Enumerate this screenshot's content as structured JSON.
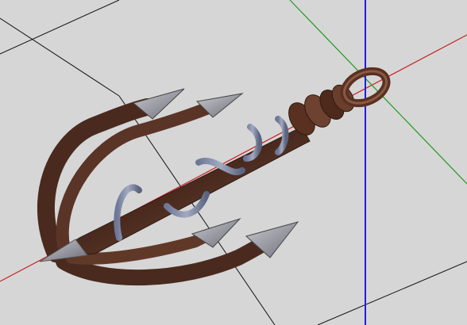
{
  "viewport": {
    "background": "#d6d6d6",
    "grid_color": "#111111",
    "axes": {
      "x_color": "#c81e1e",
      "y_color": "#1e9a1e",
      "z_color": "#1e1ee0"
    }
  },
  "model": {
    "name": "grappling hook",
    "prongs": 4,
    "rust_dark": "#4a2a1e",
    "rust_mid": "#7a4a36",
    "rust_light": "#9a6a55",
    "metal_blue": "#8a95b0",
    "steel": "#b8b8c0"
  }
}
